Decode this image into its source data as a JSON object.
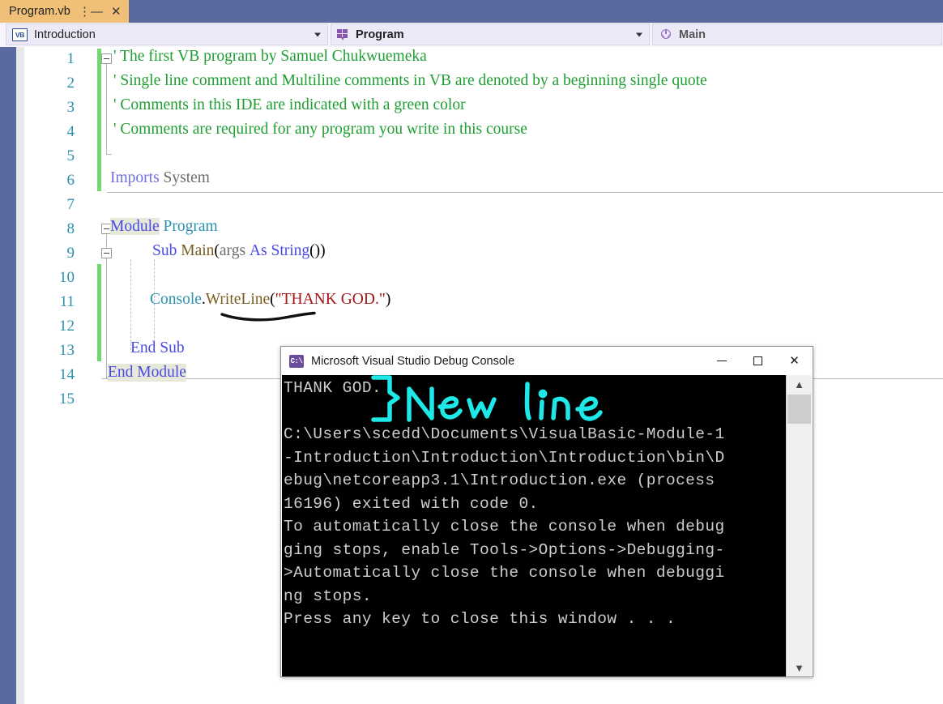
{
  "tab": {
    "filename": "Program.vb",
    "pin_icon": "pin-icon",
    "close_icon": "close-icon"
  },
  "nav": {
    "project_label": "Introduction",
    "project_icon": "vb-icon",
    "type_label": "Program",
    "type_icon": "module-icon",
    "member_label": "Main",
    "member_icon": "method-icon"
  },
  "editor": {
    "line_numbers": [
      "1",
      "2",
      "3",
      "4",
      "5",
      "6",
      "7",
      "8",
      "9",
      "10",
      "11",
      "12",
      "13",
      "14",
      "15"
    ],
    "lines": [
      {
        "n": "1",
        "text": "' The first VB program by Samuel Chukwuemeka"
      },
      {
        "n": "2",
        "text": "' Single line comment and Multiline comments in VB are denoted by a beginning single quote"
      },
      {
        "n": "3",
        "text": "' Comments in this IDE are indicated with a green color"
      },
      {
        "n": "4",
        "text": "' Comments are required for any program you write in this course"
      },
      {
        "n": "5",
        "text": ""
      },
      {
        "n": "6",
        "text": "Imports System"
      },
      {
        "n": "7",
        "text": ""
      },
      {
        "n": "8",
        "text": "Module Program"
      },
      {
        "n": "9",
        "text": "    Sub Main(args As String())"
      },
      {
        "n": "10",
        "text": ""
      },
      {
        "n": "11",
        "text": "        Console.WriteLine(\"THANK GOD.\")"
      },
      {
        "n": "12",
        "text": ""
      },
      {
        "n": "13",
        "text": "    End Sub"
      },
      {
        "n": "14",
        "text": "End Module"
      },
      {
        "n": "15",
        "text": ""
      }
    ],
    "tokens": {
      "comment1": "' The first VB program by Samuel Chukwuemeka",
      "comment2": "' Single line comment and Multiline comments in VB are denoted by a beginning single quote",
      "comment3": "' Comments in this IDE are indicated with a green color",
      "comment4": "' Comments are required for any program you write in this course",
      "imports_kw": "Imports",
      "imports_ns": "System",
      "module_kw": "Module",
      "module_name": "Program",
      "sub_kw": "Sub",
      "sub_name": "Main",
      "paren_open": "(",
      "arg_name": "args",
      "as_kw": "As",
      "string_kw": "String",
      "arg_tail": "())",
      "console_type": "Console",
      "dot": ".",
      "writeline": "WriteLine",
      "call_open": "(",
      "string_literal": "\"THANK GOD.\"",
      "call_close": ")",
      "end_sub": "End Sub",
      "end_module": "End Module"
    },
    "colors": {
      "comment": "#1f9e33",
      "keyword": "#4a4ae8",
      "type": "#2b91af",
      "string": "#a31515",
      "identifier": "#7a5c1e",
      "linenumber": "#2b91af",
      "changebar": "#6fd96f"
    }
  },
  "annotations": {
    "writeline_underline": "hand-drawn-underline",
    "newline_ink": "}New line",
    "newline_ink_color": "#1ee8e8"
  },
  "console": {
    "title": "Microsoft Visual Studio Debug Console",
    "icon": "console-icon",
    "minimize_label": "minimize-icon",
    "maximize_label": "maximize-icon",
    "close_label": "close-icon",
    "output_lines": [
      "THANK GOD.",
      "",
      "C:\\Users\\scedd\\Documents\\VisualBasic-Module-1",
      "-Introduction\\Introduction\\Introduction\\bin\\D",
      "ebug\\netcoreapp3.1\\Introduction.exe (process",
      "16196) exited with code 0.",
      "To automatically close the console when debug",
      "ging stops, enable Tools->Options->Debugging-",
      ">Automatically close the console when debuggi",
      "ng stops.",
      "Press any key to close this window . . ."
    ],
    "scroll_up_icon": "chevron-up-icon",
    "scroll_down_icon": "chevron-down-icon"
  }
}
